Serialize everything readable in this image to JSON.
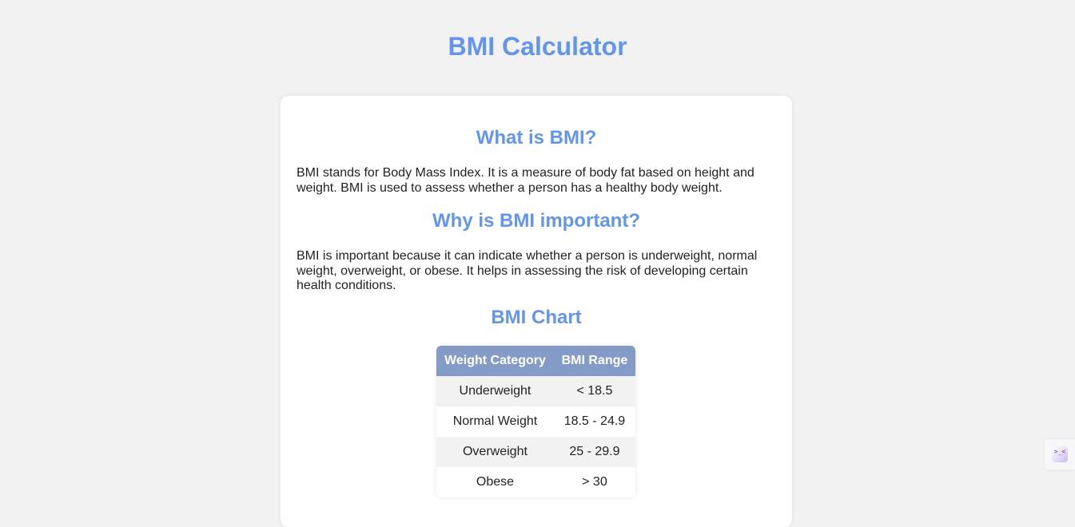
{
  "page": {
    "title": "BMI Calculator"
  },
  "card": {
    "sections": [
      {
        "heading": "What is BMI?",
        "lines": [
          "BMI stands for Body Mass Index. It is a measure of body fat based on height and",
          "weight. BMI is used to assess whether a person has a healthy body weight."
        ]
      },
      {
        "heading": "Why is BMI important?",
        "lines": [
          "BMI is important because it can indicate whether a person is underweight, normal",
          "weight, overweight, or obese. It helps in assessing the risk of developing certain",
          "health conditions."
        ]
      }
    ],
    "chart_heading": "BMI Chart",
    "table": {
      "headers": [
        "Weight Category",
        "BMI Range"
      ],
      "rows": [
        [
          "Underweight",
          "< 18.5"
        ],
        [
          "Normal Weight",
          "18.5 - 24.9"
        ],
        [
          "Overweight",
          "25 - 29.9"
        ],
        [
          "Obese",
          "> 30"
        ]
      ]
    }
  },
  "widget": {
    "icon": "extension-widget-icon",
    "glyph": ">_<"
  },
  "colors": {
    "accent": "#6495ed",
    "table_header": "#849bc8",
    "background": "#f2f2f2"
  }
}
